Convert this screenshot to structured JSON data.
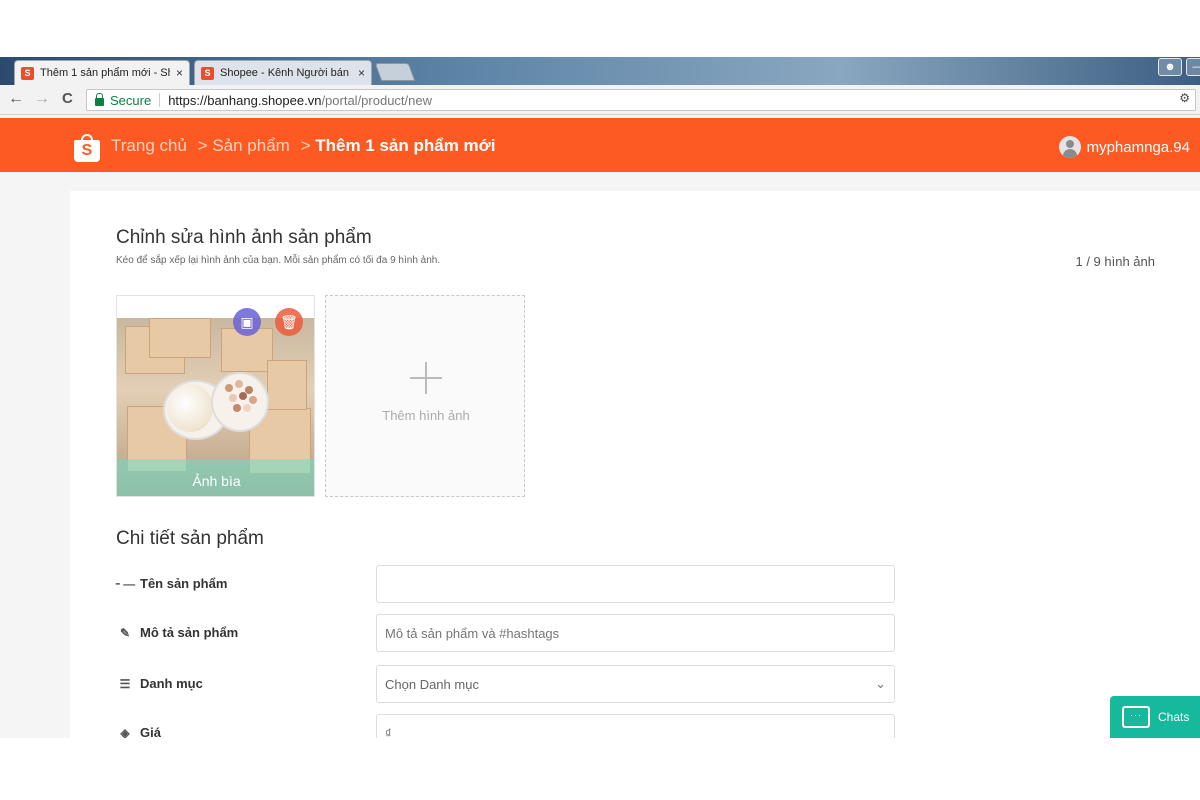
{
  "browser": {
    "tabs": [
      {
        "title": "Thêm 1 sản phẩm mới - Shopee",
        "close": "×",
        "favicon": "S"
      },
      {
        "title": "Shopee - Kênh Người bán",
        "close": "×",
        "favicon": "S"
      }
    ],
    "nav": {
      "back": "←",
      "forward": "→",
      "reload": "C"
    },
    "secure_label": "Secure",
    "url_host": "https://banhang.shopee.vn",
    "url_path": "/portal/product/new",
    "extension_icon": "puzzle-icon"
  },
  "header": {
    "logo_letter": "S",
    "breadcrumb": {
      "home": "Trang chủ",
      "sep1": ">",
      "products": "Sản phẩm",
      "sep2": ">",
      "current": "Thêm 1 sản phẩm mới"
    },
    "username": "myphamnga.94"
  },
  "images_section": {
    "title": "Chỉnh sửa hình ảnh sản phẩm",
    "subtitle": "Kéo để sắp xếp lại hình ảnh của bạn. Mỗi sản phẩm có tối đa 9 hình ảnh.",
    "count": "1 / 9 hình ảnh",
    "cover_label": "Ảnh bìa",
    "add_label": "Thêm hình ảnh"
  },
  "details_section": {
    "title": "Chi tiết sản phẩm",
    "fields": {
      "name": {
        "label": "Tên sản phẩm",
        "value": "",
        "placeholder": ""
      },
      "description": {
        "label": "Mô tả sản phẩm",
        "placeholder": "Mô tả sản phẩm và #hashtags"
      },
      "category": {
        "label": "Danh mục",
        "value": "Chọn Danh mục"
      },
      "price": {
        "label": "Giá",
        "placeholder": "₫"
      }
    }
  },
  "chat": {
    "label": "Chats"
  },
  "colors": {
    "shopee_orange": "#fc5a22",
    "chat_green": "#16b99c"
  }
}
